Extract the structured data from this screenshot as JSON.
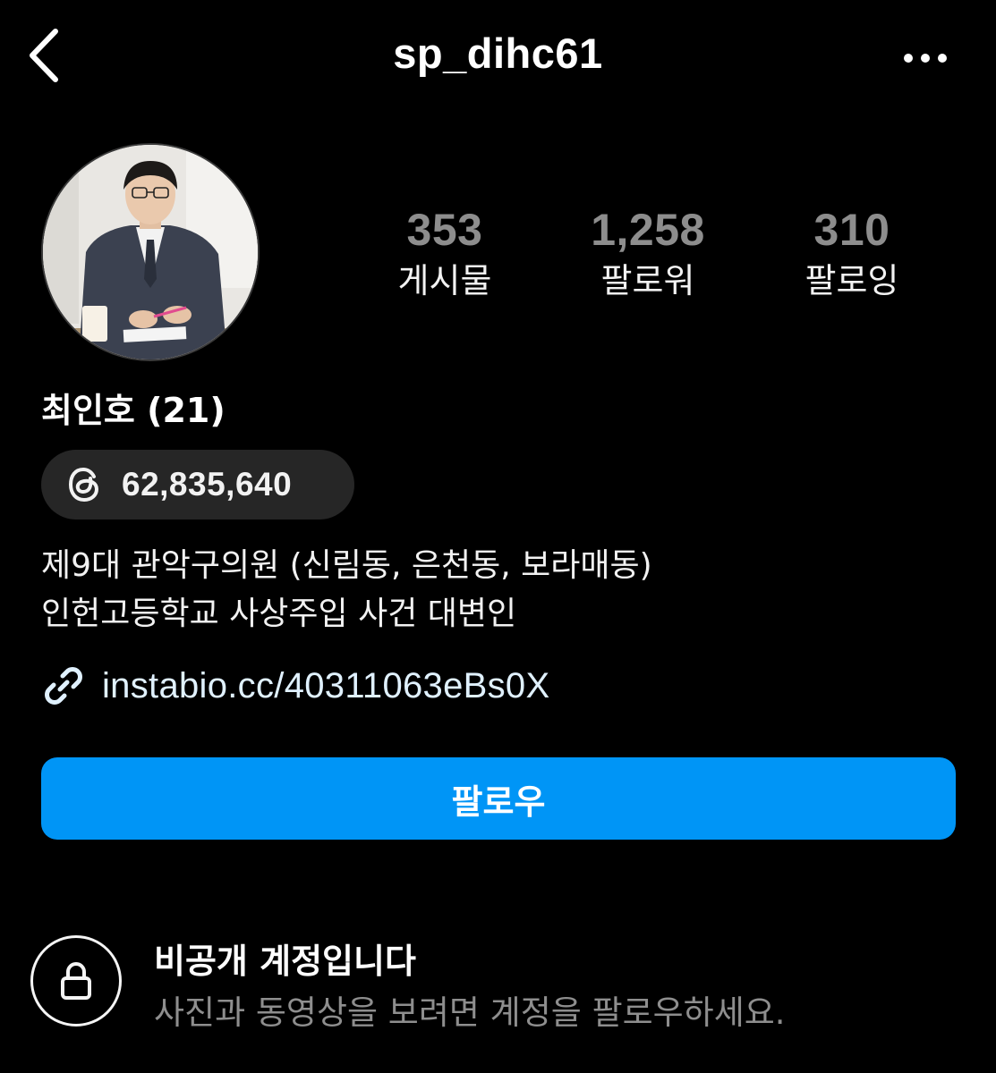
{
  "header": {
    "username": "sp_dihc61",
    "back_icon": "chevron-left-icon",
    "more_icon": "more-horizontal-icon"
  },
  "profile": {
    "display_name": "최인호 (21)",
    "stats": [
      {
        "value": "353",
        "label": "게시물"
      },
      {
        "value": "1,258",
        "label": "팔로워"
      },
      {
        "value": "310",
        "label": "팔로잉"
      }
    ],
    "threads": {
      "icon": "threads-logo-icon",
      "count": "62,835,640"
    },
    "bio_lines": [
      "제9대 관악구의원 (신림동, 은천동, 보라매동)",
      "인헌고등학교 사상주입 사건 대변인"
    ],
    "link": {
      "icon": "link-icon",
      "url": "instabio.cc/40311063eBs0X"
    }
  },
  "actions": {
    "follow_label": "팔로우",
    "follow_color": "#0095f6"
  },
  "private_notice": {
    "icon": "lock-icon",
    "title": "비공개 계정입니다",
    "subtitle": "사진과 동영상을 보려면 계정을 팔로우하세요."
  },
  "colors": {
    "background": "#000000",
    "stat_number": "#8d8d8d",
    "pill_background": "#262626",
    "muted_text": "#8e8e8e"
  }
}
